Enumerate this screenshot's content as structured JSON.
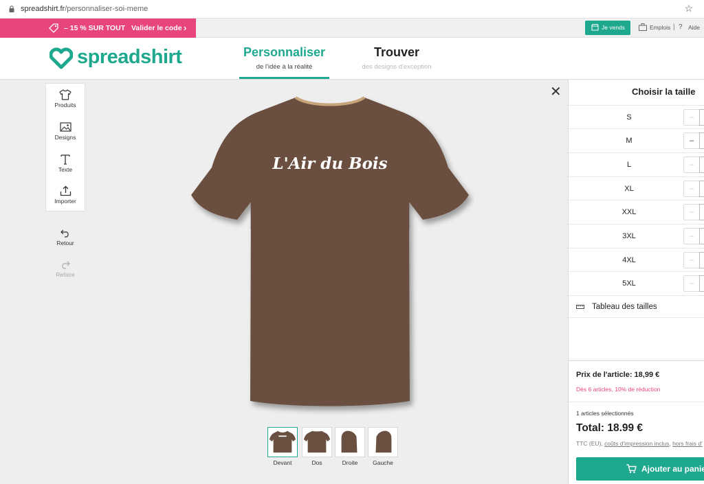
{
  "browser": {
    "url_domain": "spreadshirt.fr",
    "url_path": "/personnaliser-soi-meme"
  },
  "promo": {
    "text": "– 15 % SUR TOUT",
    "code_label": "Valider le code"
  },
  "topbar": {
    "sell_label": "Je vends",
    "jobs_label": "Emplois",
    "separator": "|",
    "help_label": "Aide"
  },
  "header": {
    "logo_text": "spreadshirt",
    "tabs": [
      {
        "title": "Personnaliser",
        "subtitle": "de l'idée à la réalité",
        "active": true
      },
      {
        "title": "Trouver",
        "subtitle": "des designs d'exception",
        "active": false
      }
    ]
  },
  "tools": [
    {
      "label": "Produits",
      "icon": "tshirt-icon"
    },
    {
      "label": "Designs",
      "icon": "image-icon"
    },
    {
      "label": "Texte",
      "icon": "text-icon"
    },
    {
      "label": "Importer",
      "icon": "upload-icon"
    }
  ],
  "history": {
    "undo_label": "Retour",
    "redo_label": "Refaire"
  },
  "product": {
    "shirt_color": "#6a5041",
    "print_text": "L'Air du Bois",
    "views": [
      {
        "label": "Devant",
        "selected": true
      },
      {
        "label": "Dos",
        "selected": false
      },
      {
        "label": "Droite",
        "selected": false
      },
      {
        "label": "Gauche",
        "selected": false
      }
    ]
  },
  "size_panel": {
    "title": "Choisir la taille",
    "sizes": [
      {
        "label": "S",
        "active": false
      },
      {
        "label": "M",
        "active": true
      },
      {
        "label": "L",
        "active": false
      },
      {
        "label": "XL",
        "active": false
      },
      {
        "label": "XXL",
        "active": false
      },
      {
        "label": "3XL",
        "active": false
      },
      {
        "label": "4XL",
        "active": false
      },
      {
        "label": "5XL",
        "active": false
      }
    ],
    "minus_symbol": "–",
    "size_guide_label": "Tableau des tailles"
  },
  "pricing": {
    "price_line": "Prix de l'article: 18,99 €",
    "discount_line": "Dès 6 articles, 10% de réduction",
    "selected_count": "1 articles sélectionnés",
    "total": "Total: 18.99 €",
    "tax_prefix": "TTC (EU),",
    "tax_link1": "coûts d'impression inclus",
    "tax_sep": ",",
    "tax_link2": "hors frais d'",
    "add_to_cart": "Ajouter au panier"
  },
  "colors": {
    "accent": "#1ea88e",
    "promo": "#e8457b"
  }
}
